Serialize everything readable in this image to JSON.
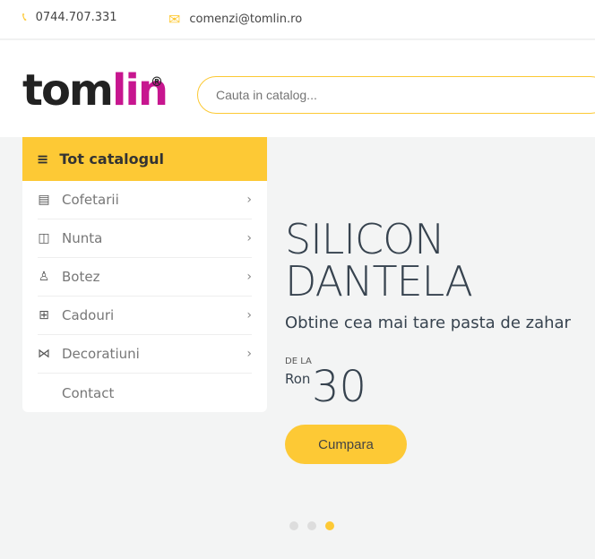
{
  "topbar": {
    "phone": "0744.707.331",
    "email": "comenzi@tomlin.ro"
  },
  "logo": {
    "part1": "tom",
    "part2": "lin",
    "reg": "®"
  },
  "search": {
    "placeholder": "Cauta in catalog..."
  },
  "menu": {
    "title": "Tot catalogul",
    "items": [
      {
        "label": "Cofetarii",
        "icon": "cake-icon"
      },
      {
        "label": "Nunta",
        "icon": "suit-icon"
      },
      {
        "label": "Botez",
        "icon": "baby-icon"
      },
      {
        "label": "Cadouri",
        "icon": "gift-icon"
      },
      {
        "label": "Decoratiuni",
        "icon": "garland-icon"
      },
      {
        "label": "Contact"
      }
    ]
  },
  "hero": {
    "title_line1": "SILICON",
    "title_line2": "DANTELA",
    "subtitle": "Obtine cea mai tare pasta de zahar",
    "from": "DE LA",
    "currency": "Ron",
    "price": "30",
    "button": "Cumpara",
    "slides": 3,
    "active_slide": 3
  },
  "colors": {
    "accent": "#fdc935",
    "brand": "#c7168f"
  }
}
